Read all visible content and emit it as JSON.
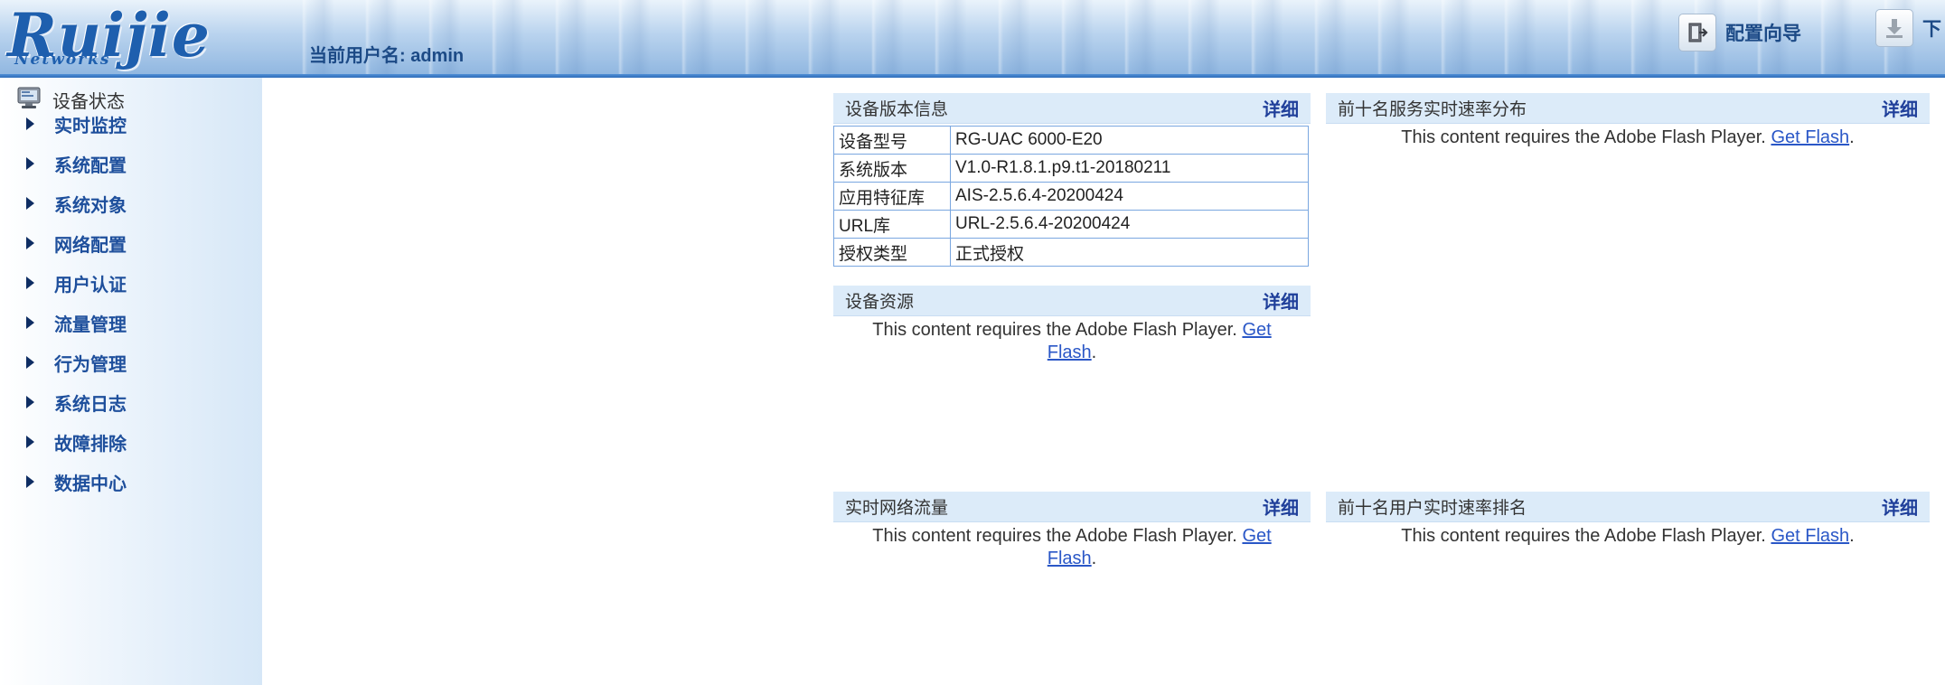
{
  "header": {
    "logo_text": "Ruijie",
    "logo_sub": "Networks",
    "current_user": "当前用户名: admin",
    "wizard_label": "配置向导",
    "download_label": "下"
  },
  "sidebar": {
    "status_label": "设备状态",
    "items": [
      {
        "label": "实时监控"
      },
      {
        "label": "系统配置"
      },
      {
        "label": "系统对象"
      },
      {
        "label": "网络配置"
      },
      {
        "label": "用户认证"
      },
      {
        "label": "流量管理"
      },
      {
        "label": "行为管理"
      },
      {
        "label": "系统日志"
      },
      {
        "label": "故障排除"
      },
      {
        "label": "数据中心"
      }
    ]
  },
  "panels": {
    "version": {
      "title": "设备版本信息",
      "more": "详细",
      "rows": [
        {
          "key": "设备型号",
          "value": "RG-UAC 6000-E20"
        },
        {
          "key": "系统版本",
          "value": "V1.0-R1.8.1.p9.t1-20180211"
        },
        {
          "key": "应用特征库",
          "value": "AIS-2.5.6.4-20200424"
        },
        {
          "key": "URL库",
          "value": "URL-2.5.6.4-20200424"
        },
        {
          "key": "授权类型",
          "value": "正式授权"
        }
      ]
    },
    "resources": {
      "title": "设备资源",
      "more": "详细"
    },
    "top_services": {
      "title": "前十名服务实时速率分布",
      "more": "详细"
    },
    "traffic": {
      "title": "实时网络流量",
      "more": "详细"
    },
    "top_users": {
      "title": "前十名用户实时速率排名",
      "more": "详细"
    }
  },
  "flash": {
    "message": "This content requires the Adobe Flash Player.",
    "link_get": "Get",
    "link_flash": "Flash",
    "link_full": "Get Flash",
    "period": "."
  },
  "colors": {
    "brand_blue": "#1e5fae",
    "panel_header_bg": "#dcebf9",
    "link_blue": "#2a57c7",
    "detail_link": "#1f3f9a"
  }
}
